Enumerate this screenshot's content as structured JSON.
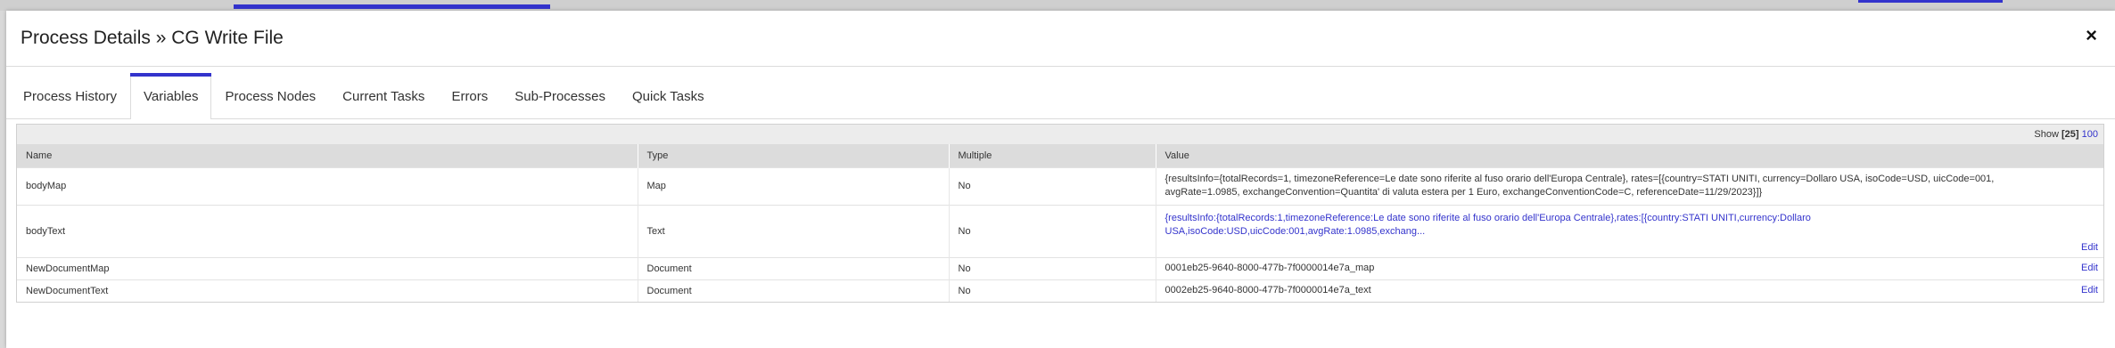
{
  "modal": {
    "title": "Process Details » CG Write File",
    "close_glyph": "×"
  },
  "tabs": [
    {
      "label": "Process History",
      "active": false
    },
    {
      "label": "Variables",
      "active": true
    },
    {
      "label": "Process Nodes",
      "active": false
    },
    {
      "label": "Current Tasks",
      "active": false
    },
    {
      "label": "Errors",
      "active": false
    },
    {
      "label": "Sub-Processes",
      "active": false
    },
    {
      "label": "Quick Tasks",
      "active": false
    }
  ],
  "pager": {
    "show_label": "Show",
    "current": "[25]",
    "alt": "100"
  },
  "table": {
    "headers": [
      "Name",
      "Type",
      "Multiple",
      "Value"
    ],
    "rows": [
      {
        "name": "bodyMap",
        "type": "Map",
        "multiple": "No",
        "value": "{resultsInfo={totalRecords=1, timezoneReference=Le date sono riferite al fuso orario dell'Europa Centrale}, rates=[{country=STATI UNITI, currency=Dollaro USA, isoCode=USD, uicCode=001, avgRate=1.0985, exchangeConvention=Quantita' di valuta estera per 1 Euro, exchangeConventionCode=C, referenceDate=11/29/2023}]}",
        "value_is_link": false,
        "edit": ""
      },
      {
        "name": "bodyText",
        "type": "Text",
        "multiple": "No",
        "value": "{resultsInfo:{totalRecords:1,timezoneReference:Le date sono riferite al fuso orario dell'Europa Centrale},rates:[{country:STATI UNITI,currency:Dollaro USA,isoCode:USD,uicCode:001,avgRate:1.0985,exchang...",
        "value_is_link": true,
        "edit": "Edit"
      },
      {
        "name": "NewDocumentMap",
        "type": "Document",
        "multiple": "No",
        "value": "0001eb25-9640-8000-477b-7f0000014e7a_map",
        "value_is_link": false,
        "edit": "Edit"
      },
      {
        "name": "NewDocumentText",
        "type": "Document",
        "multiple": "No",
        "value": "0002eb25-9640-8000-477b-7f0000014e7a_text",
        "value_is_link": false,
        "edit": "Edit"
      }
    ]
  },
  "colors": {
    "accent": "#3333cc",
    "header_bg": "#dcdcdc"
  }
}
